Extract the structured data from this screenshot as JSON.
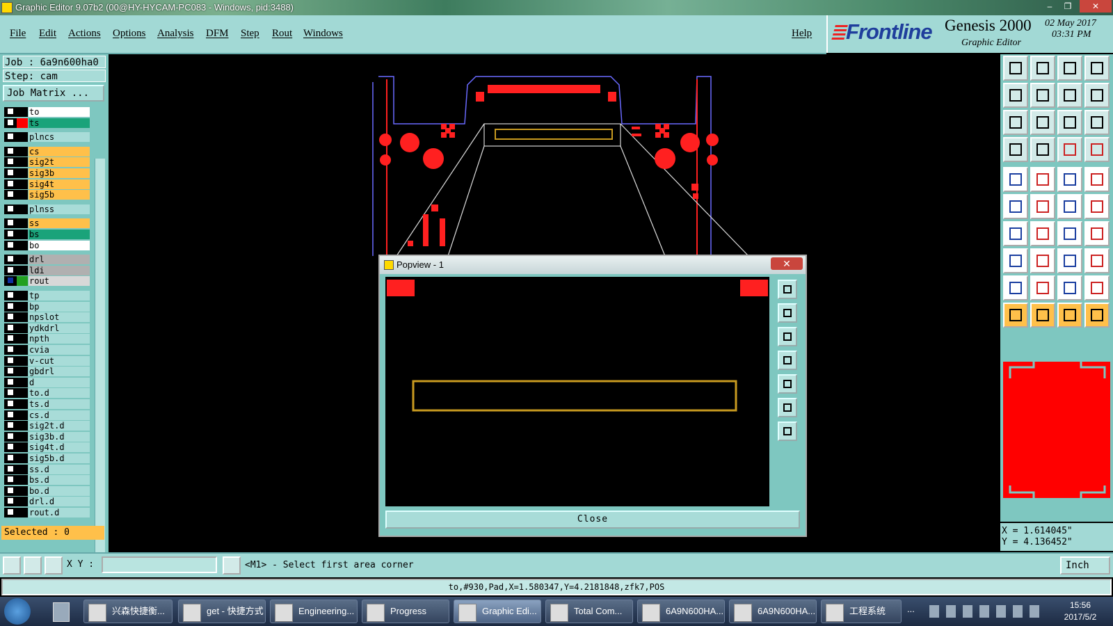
{
  "window": {
    "title": "Graphic Editor 9.07b2 (00@HY-HYCAM-PC083 - Windows, pid:3488)",
    "controls": [
      "–",
      "❐",
      "✕"
    ]
  },
  "menu": {
    "items": [
      "File",
      "Edit",
      "Actions",
      "Options",
      "Analysis",
      "DFM",
      "Step",
      "Rout",
      "Windows"
    ],
    "help": "Help"
  },
  "logo": {
    "brand": "Frontline",
    "product": "Genesis 2000",
    "subtitle": "Graphic Editor",
    "date": "02 May 2017",
    "time": "03:31 PM"
  },
  "job": {
    "job_line": "Job : 6a9n600ha0",
    "step_line": "Step: cam",
    "job_matrix": "Job Matrix ..."
  },
  "layers": [
    {
      "name": "to",
      "bg": "#ffffff",
      "swatch": "#000000"
    },
    {
      "name": "ts",
      "bg": "#1aa37a",
      "swatch": "#ff0000"
    },
    {
      "name": "plncs",
      "bg": "#a8dcd8",
      "swatch": "#000000",
      "gap": true
    },
    {
      "name": "cs",
      "bg": "#ffc04a",
      "swatch": "#000000",
      "gap": true
    },
    {
      "name": "sig2t",
      "bg": "#ffc04a",
      "swatch": "#000000"
    },
    {
      "name": "sig3b",
      "bg": "#ffc04a",
      "swatch": "#000000"
    },
    {
      "name": "sig4t",
      "bg": "#ffc04a",
      "swatch": "#000000"
    },
    {
      "name": "sig5b",
      "bg": "#ffc04a",
      "swatch": "#000000"
    },
    {
      "name": "plnss",
      "bg": "#a8dcd8",
      "swatch": "#000000",
      "gap": true
    },
    {
      "name": "ss",
      "bg": "#ffc04a",
      "swatch": "#000000",
      "gap": true
    },
    {
      "name": "bs",
      "bg": "#1aa37a",
      "swatch": "#000000"
    },
    {
      "name": "bo",
      "bg": "#ffffff",
      "swatch": "#000000"
    },
    {
      "name": "drl",
      "bg": "#b0b0b0",
      "swatch": "#000000",
      "gap": true
    },
    {
      "name": "ldi",
      "bg": "#b0b0b0",
      "swatch": "#000000"
    },
    {
      "name": "rout",
      "bg": "#d8d8d8",
      "swatch": "#22a020",
      "cb": "#1030a0"
    },
    {
      "name": "tp",
      "bg": "#a8dcd8",
      "swatch": "#000000",
      "gap": true
    },
    {
      "name": "bp",
      "bg": "#a8dcd8",
      "swatch": "#000000"
    },
    {
      "name": "npslot",
      "bg": "#a8dcd8",
      "swatch": "#000000"
    },
    {
      "name": "ydkdrl",
      "bg": "#a8dcd8",
      "swatch": "#000000"
    },
    {
      "name": "npth",
      "bg": "#a8dcd8",
      "swatch": "#000000"
    },
    {
      "name": "cvia",
      "bg": "#a8dcd8",
      "swatch": "#000000"
    },
    {
      "name": "v-cut",
      "bg": "#a8dcd8",
      "swatch": "#000000"
    },
    {
      "name": "gbdrl",
      "bg": "#a8dcd8",
      "swatch": "#000000"
    },
    {
      "name": "d",
      "bg": "#a8dcd8",
      "swatch": "#000000"
    },
    {
      "name": "to.d",
      "bg": "#a8dcd8",
      "swatch": "#000000"
    },
    {
      "name": "ts.d",
      "bg": "#a8dcd8",
      "swatch": "#000000"
    },
    {
      "name": "cs.d",
      "bg": "#a8dcd8",
      "swatch": "#000000"
    },
    {
      "name": "sig2t.d",
      "bg": "#a8dcd8",
      "swatch": "#000000"
    },
    {
      "name": "sig3b.d",
      "bg": "#a8dcd8",
      "swatch": "#000000"
    },
    {
      "name": "sig4t.d",
      "bg": "#a8dcd8",
      "swatch": "#000000"
    },
    {
      "name": "sig5b.d",
      "bg": "#a8dcd8",
      "swatch": "#000000"
    },
    {
      "name": "ss.d",
      "bg": "#a8dcd8",
      "swatch": "#000000"
    },
    {
      "name": "bs.d",
      "bg": "#a8dcd8",
      "swatch": "#000000"
    },
    {
      "name": "bo.d",
      "bg": "#a8dcd8",
      "swatch": "#000000"
    },
    {
      "name": "drl.d",
      "bg": "#a8dcd8",
      "swatch": "#000000"
    },
    {
      "name": "rout.d",
      "bg": "#a8dcd8",
      "swatch": "#000000"
    }
  ],
  "selected": "Selected : 0",
  "popview": {
    "title": "Popview - 1",
    "close_label": "Close",
    "tools": [
      "zoom-window-icon",
      "pan-up-icon",
      "pan-down-icon",
      "pan-left-icon",
      "pan-right-icon",
      "zoom-fit-icon",
      "zoom-center-icon"
    ]
  },
  "right_tools": [
    "pan-up-icon",
    "pan-down-icon",
    "home-icon",
    "zoom-window-icon",
    "pan-left-icon",
    "pan-right-icon",
    "undo-zoom-icon",
    "redo-zoom-icon",
    "fit-vertical-icon",
    "fit-all-icon",
    "scale-1-2-icon",
    "query-icon",
    "measure-icon",
    "grid-icon",
    "layer-compare-icon",
    "layer-swap-icon",
    "pad-select-icon",
    "net-icon",
    "ruler-icon",
    "circle-fill-icon",
    "connect-icon",
    "cross-icon",
    "line-add-icon",
    "line-extend-icon",
    "slash-red-icon",
    "slash-blue-icon",
    "arc-icon",
    "feature-icon",
    "pad-move-icon",
    "dash-icon",
    "dimension-icon",
    "copy-icon",
    "triangle-1-icon",
    "triangle-2-icon",
    "triangle-3-icon",
    "triangle-4-icon",
    "pointer-icon",
    "pointer-select-icon",
    "pointer-highlight-icon",
    "pointer-move-icon"
  ],
  "coords": {
    "x": "X = 1.614045\"",
    "y": "Y = 4.136452\""
  },
  "command": {
    "xy_label": "X Y :",
    "xy_value": "",
    "message": "<M1> - Select first area corner",
    "unit": "Inch"
  },
  "status": "to,#930,Pad,X=1.580347,Y=4.2181848,zfk7,POS",
  "taskbar": {
    "items": [
      {
        "label": "兴森快捷衡...",
        "icon": "flower-icon"
      },
      {
        "label": "get - 快捷方式",
        "icon": "eye-icon"
      },
      {
        "label": "Engineering...",
        "icon": "app-x-icon"
      },
      {
        "label": "Progress",
        "icon": "app-x-icon"
      },
      {
        "label": "Graphic Edi...",
        "icon": "app-x-icon"
      },
      {
        "label": "Total Com...",
        "icon": "floppy-icon"
      },
      {
        "label": "6A9N600HA...",
        "icon": "excel-icon"
      },
      {
        "label": "6A9N600HA...",
        "icon": "excel-icon"
      },
      {
        "label": "工程系统",
        "icon": "frontline-f-icon"
      }
    ],
    "time": "15:56",
    "date": "2017/5/2",
    "tray_more": "..."
  }
}
